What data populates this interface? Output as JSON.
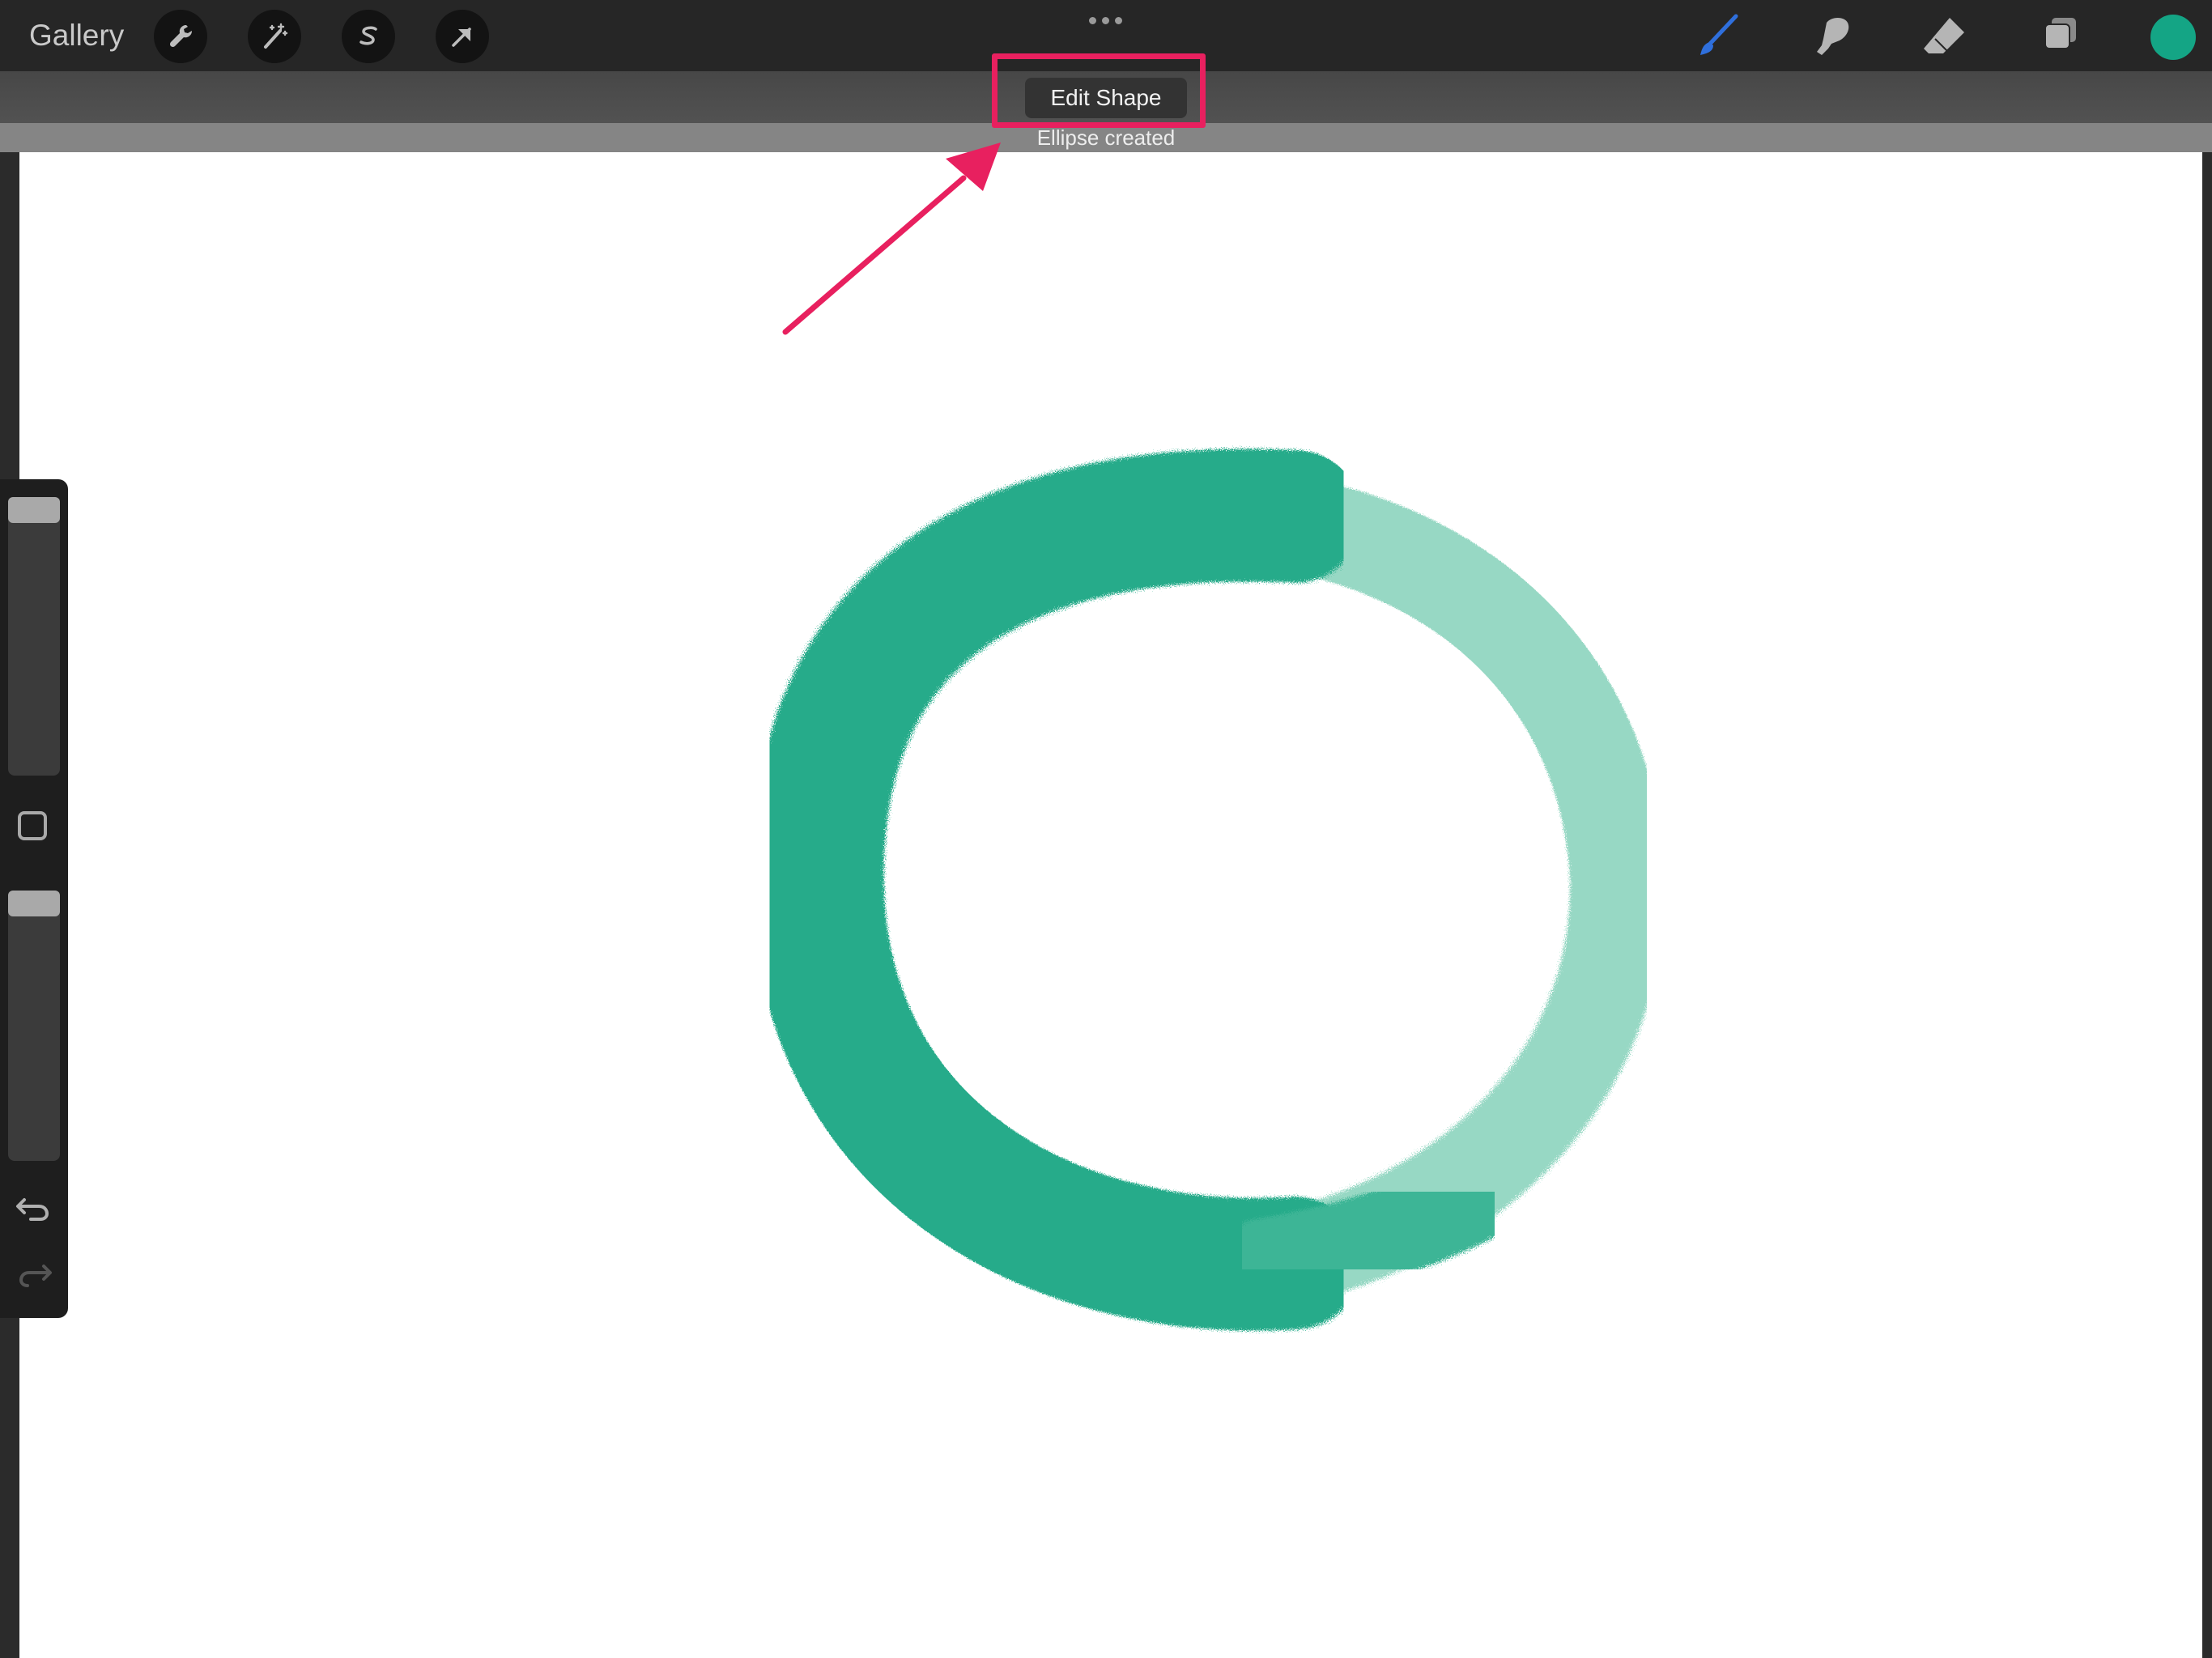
{
  "topbar": {
    "gallery_label": "Gallery",
    "left_tools": [
      "wrench-icon",
      "magic-wand-icon",
      "selection-icon",
      "transform-arrow-icon"
    ],
    "right_tools": [
      "brush-icon",
      "smudge-icon",
      "eraser-icon",
      "layers-icon"
    ],
    "active_tool": "brush-icon",
    "active_tool_color": "#2f6fdc",
    "current_color": "#14a585"
  },
  "notification": {
    "button_label": "Edit Shape",
    "message": "Ellipse created"
  },
  "annotation": {
    "highlight_color": "#e8205f"
  },
  "sidebar": {
    "brush_size_slider": "slider",
    "modify_button": "square-icon",
    "opacity_slider": "slider",
    "undo_icon": "undo-icon",
    "redo_icon": "redo-icon"
  },
  "canvas": {
    "stroke_color": "#1fa884",
    "shape": "ellipse"
  }
}
